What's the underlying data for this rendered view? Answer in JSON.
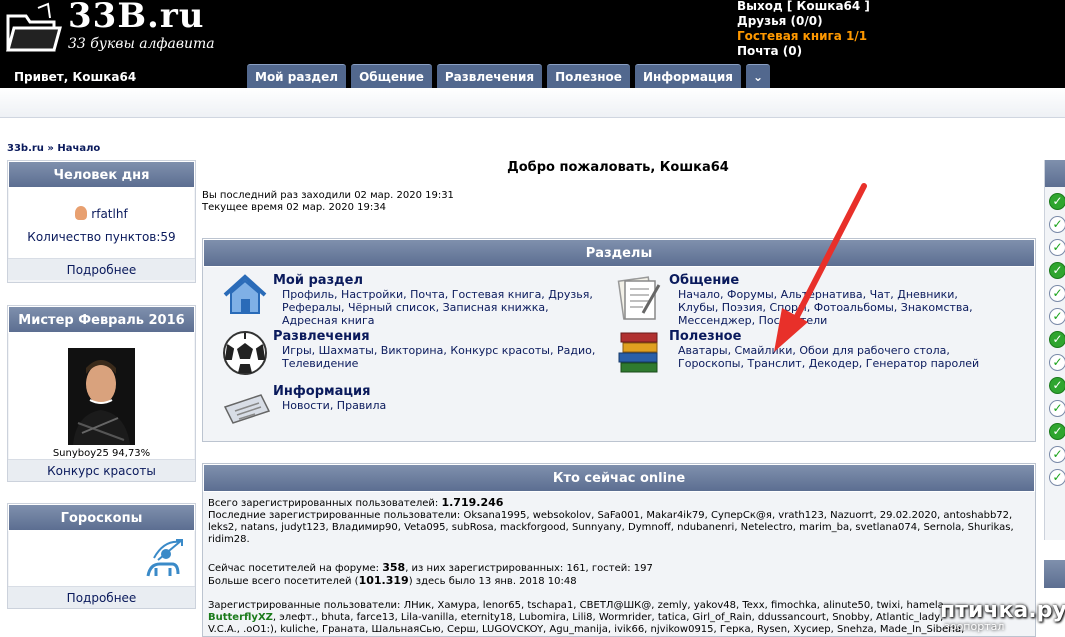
{
  "header": {
    "logo_title": "33B.ru",
    "logo_subtitle": "33 буквы алфавита",
    "greeting": "Привет, Кошка64",
    "user_links": {
      "logout": "Выход [ Кошка64 ]",
      "friends": "Друзья (0/0)",
      "guestbook": "Гостевая книга 1/1",
      "mail": "Почта (0)"
    },
    "nav": [
      "Мой раздел",
      "Общение",
      "Развлечения",
      "Полезное",
      "Информация"
    ],
    "nav_more": "⌄"
  },
  "breadcrumb": {
    "site": "33b.ru",
    "sep": "»",
    "page": "Начало"
  },
  "left": {
    "person_of_day": {
      "title": "Человек дня",
      "user": "rfatlhf",
      "points": "Количество пунктов:59",
      "more": "Подробнее"
    },
    "mister": {
      "title": "Мистер Февраль 2016",
      "caption": "Sunyboy25 94,73%",
      "more": "Конкурс красоты"
    },
    "horoscope": {
      "title": "Гороскопы",
      "more": "Подробнее"
    }
  },
  "center": {
    "welcome": "Добро пожаловать, Кошка64",
    "last_visit": "Вы последний раз заходили 02 мар. 2020 19:31",
    "current_time": "Текущее время 02 мар. 2020 19:34",
    "sections_title": "Разделы",
    "sections": [
      {
        "title": "Мой раздел",
        "links": "Профиль, Настройки, Почта, Гостевая книга, Друзья, Рефералы, Чёрный список, Записная книжка, Адресная книга"
      },
      {
        "title": "Общение",
        "links": "Начало, Форумы, Альтернатива, Чат, Дневники, Клубы, Поэзия, Споры, Фотоальбомы, Знакомства, Мессенджер, Посетители"
      },
      {
        "title": "Развлечения",
        "links": "Игры, Шахматы, Викторина, Конкурс красоты, Радио, Телевидение"
      },
      {
        "title": "Полезное",
        "links": "Аватары, Смайлики, Обои для рабочего стола, Гороскопы, Транслит, Декодер, Генератор паролей"
      },
      {
        "title": "Информация",
        "links": "Новости, Правила"
      }
    ],
    "online_title": "Кто сейчас online",
    "online": {
      "total_label": "Всего зарегистрированных пользователей:",
      "total_value": "1.719.246",
      "last_label": "Последние зарегистрированные пользователи:",
      "last_users": "Oksana1995, websokolov, SaFa001, Makar4ik79, СуперСк@я, vrath123, Nazuorrt, 29.02.2020, antoshabb72, leks2, natans, judyt123, Владимир90, Veta095, subRosa, mackforgood, Sunnyany, Dymnoff, ndubanenri, Netelectro, marim_ba, svetlana074, Sernola, Shurikas, ridim28.",
      "now_label": "Сейчас посетителей на форуме:",
      "now_value": "358",
      "now_rest": ", из них зарегистрированных: 161, гостей: 197",
      "max_prefix": "Больше всего посетителей (",
      "max_value": "101.319",
      "max_rest": ") здесь было 13 янв. 2018 10:48",
      "reg_label": "Зарегистрированные пользователи:",
      "reg_line1": "ЛНик, Хамура, lenor65, tschapa1, СВЕТЛ@ШК@, zemly, yakov48, Texx, fimochka, alinute50, twixi, hamela,",
      "reg_green": "ButterflyXZ",
      "reg_line2": ", элефт., bhuta, farce13, Lila-vanilla, eternity18, Lubomira, Lili8, Wormrider, tatica, Girl_of_Rain, ddussancourt, Snobby, Atlantic_lady,",
      "reg_line3": "V.C.A., .oO1:), kuliche, Граната, ШальнаяСью, Серш, LUGOVCKOY, Agu_manija, ivik66, njvikow0915, Герка, Rysen, Хусиер, Snehza, Made_In_Siberia,"
    }
  },
  "watermark": {
    "main": "птичка.ру",
    "sub": "зоопортал"
  },
  "colors": {
    "header_bg": "#000000",
    "tab_bg": "#52688e",
    "box_head": "#6a7c9e",
    "orange": "#ff9900",
    "link": "#0a1a5c",
    "arrow": "#e8302a"
  }
}
